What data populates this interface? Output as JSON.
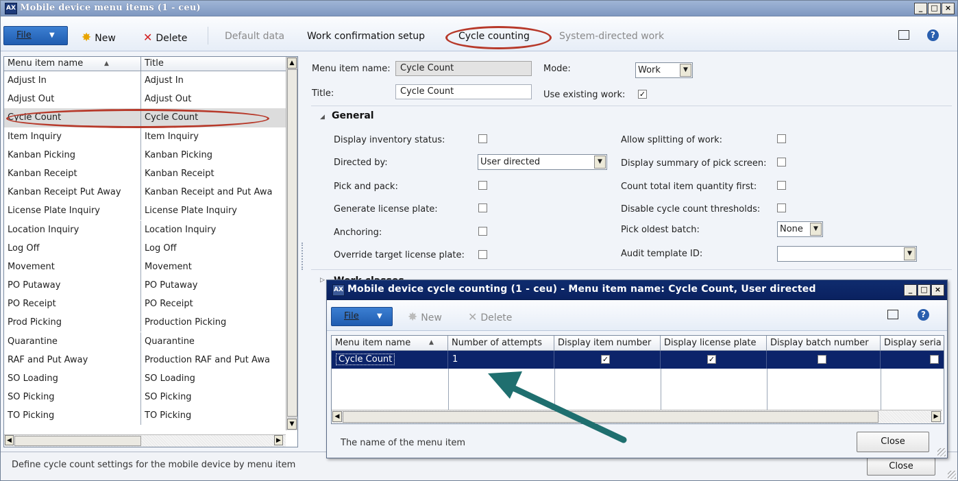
{
  "main_window": {
    "title": "Mobile device menu items (1 - ceu)",
    "app_icon": "dynamics-ax-icon",
    "controls": {
      "minimize": "_",
      "maximize": "□",
      "close": "×"
    }
  },
  "toolbar": {
    "file": "File",
    "new": "New",
    "delete": "Delete",
    "default_data": "Default data",
    "work_confirmation": "Work confirmation setup",
    "cycle_counting": "Cycle counting",
    "system_directed": "System-directed work",
    "highlight_color": "#b7392a"
  },
  "grid": {
    "columns": [
      "Menu item name",
      "Title"
    ],
    "rows": [
      [
        "Adjust In",
        "Adjust In"
      ],
      [
        "Adjust Out",
        "Adjust Out"
      ],
      [
        "Cycle Count",
        "Cycle Count"
      ],
      [
        "Item Inquiry",
        "Item Inquiry"
      ],
      [
        "Kanban Picking",
        "Kanban Picking"
      ],
      [
        "Kanban Receipt",
        "Kanban Receipt"
      ],
      [
        "Kanban Receipt Put Away",
        "Kanban Receipt and Put Awa"
      ],
      [
        "License Plate Inquiry",
        "License Plate Inquiry"
      ],
      [
        "Location Inquiry",
        "Location Inquiry"
      ],
      [
        "Log Off",
        "Log Off"
      ],
      [
        "Movement",
        "Movement"
      ],
      [
        "PO Putaway",
        "PO Putaway"
      ],
      [
        "PO Receipt",
        "PO Receipt"
      ],
      [
        "Prod Picking",
        "Production Picking"
      ],
      [
        "Quarantine",
        "Quarantine"
      ],
      [
        "RAF and Put Away",
        "Production RAF and Put Awa"
      ],
      [
        "SO Loading",
        "SO Loading"
      ],
      [
        "SO Picking",
        "SO Picking"
      ],
      [
        "TO Picking",
        "TO Picking"
      ]
    ],
    "selected_index": 2
  },
  "detail": {
    "menu_item_name_label": "Menu item name:",
    "menu_item_name": "Cycle Count",
    "title_label": "Title:",
    "title": "Cycle Count",
    "mode_label": "Mode:",
    "mode": "Work",
    "use_existing_label": "Use existing work:",
    "use_existing": true,
    "general": {
      "heading": "General",
      "display_inventory_status": "Display inventory status:",
      "directed_by_label": "Directed by:",
      "directed_by": "User directed",
      "pick_and_pack": "Pick and pack:",
      "generate_license_plate": "Generate license plate:",
      "anchoring": "Anchoring:",
      "override_target": "Override target license plate:",
      "allow_splitting": "Allow splitting of work:",
      "display_summary": "Display summary of pick screen:",
      "count_total": "Count total item quantity first:",
      "disable_thresholds": "Disable cycle count thresholds:",
      "pick_oldest_label": "Pick oldest batch:",
      "pick_oldest": "None",
      "audit_template_label": "Audit template ID:",
      "audit_template": ""
    },
    "work_classes_heading": "Work classes"
  },
  "status": {
    "message": "Define cycle count settings for the mobile device by menu item",
    "close": "Close"
  },
  "sub_window": {
    "title": "Mobile device cycle counting (1 - ceu) - Menu item name: Cycle Count, User directed",
    "file": "File",
    "new": "New",
    "delete": "Delete",
    "columns": [
      "Menu item name",
      "Number of attempts",
      "Display item number",
      "Display license plate",
      "Display batch number",
      "Display seria"
    ],
    "row": {
      "menu_item_name": "Cycle Count",
      "attempts": "1",
      "display_item_number": true,
      "display_license_plate": true,
      "display_batch_number": false,
      "display_serial": false
    },
    "footer_message": "The name of the menu item",
    "close": "Close",
    "arrow_color": "#1f6f6f"
  }
}
